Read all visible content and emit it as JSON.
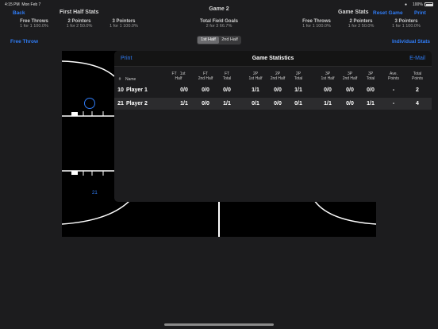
{
  "status_bar": {
    "time": "4:15 PM",
    "date": "Mon Feb 7",
    "battery": "100%"
  },
  "header": {
    "back_label": "Back",
    "left_title": "First Half Stats",
    "center_title": "Game 2",
    "right_title": "Game Stats",
    "reset_label": "Reset Game",
    "print_label": "Print",
    "center_stat_title": "Total Field Goals",
    "center_stat_value": "2 for 3  66.7%",
    "left_stats": [
      {
        "title": "Free Throws",
        "value": "1 for 1  100.0%"
      },
      {
        "title": "2 Pointers",
        "value": "1 for 2  50.0%"
      },
      {
        "title": "3 Pointers",
        "value": "1 for 1  100.0%"
      }
    ],
    "right_stats": [
      {
        "title": "Free Throws",
        "value": "1 for 1  100.0%"
      },
      {
        "title": "2 Pointers",
        "value": "1 for 2  50.0%"
      },
      {
        "title": "3 Pointers",
        "value": "1 for 1  100.0%"
      }
    ]
  },
  "free_throw_label": "Free Throw",
  "individual_stats_label": "Individual Stats",
  "segment": {
    "options": [
      "1st Half",
      "2nd Half"
    ],
    "selected": "1st Half"
  },
  "court": {
    "marker_number": "21"
  },
  "modal": {
    "print_label": "Print",
    "title": "Game Statistics",
    "email_label": "E-Mail",
    "columns": [
      {
        "line1": "#",
        "line2": ""
      },
      {
        "line1": "Name",
        "line2": ""
      },
      {
        "line1": "FT",
        "line2": "Half",
        "extra": "1st"
      },
      {
        "line1": "FT",
        "line2": "2nd Half"
      },
      {
        "line1": "FT",
        "line2": "Total"
      },
      {
        "line1": "2P",
        "line2": "1st Half"
      },
      {
        "line1": "2P",
        "line2": "2nd Half"
      },
      {
        "line1": "2P",
        "line2": "Total"
      },
      {
        "line1": "3P",
        "line2": "1st Half"
      },
      {
        "line1": "3P",
        "line2": "2nd Half"
      },
      {
        "line1": "3P",
        "line2": "Total"
      },
      {
        "line1": "Ave.",
        "line2": "Points"
      },
      {
        "line1": "Total",
        "line2": "Points"
      }
    ],
    "rows": [
      {
        "num": "10",
        "name": "Player 1",
        "ft1": "0/0",
        "ft2": "0/0",
        "ftt": "0/0",
        "p21": "1/1",
        "p22": "0/0",
        "p2t": "1/1",
        "p31": "0/0",
        "p32": "0/0",
        "p3t": "0/0",
        "ave": "-",
        "total": "2"
      },
      {
        "num": "21",
        "name": "Player 2",
        "ft1": "1/1",
        "ft2": "0/0",
        "ftt": "1/1",
        "p21": "0/1",
        "p22": "0/0",
        "p2t": "0/1",
        "p31": "1/1",
        "p32": "0/0",
        "p3t": "1/1",
        "ave": "-",
        "total": "4"
      }
    ]
  }
}
